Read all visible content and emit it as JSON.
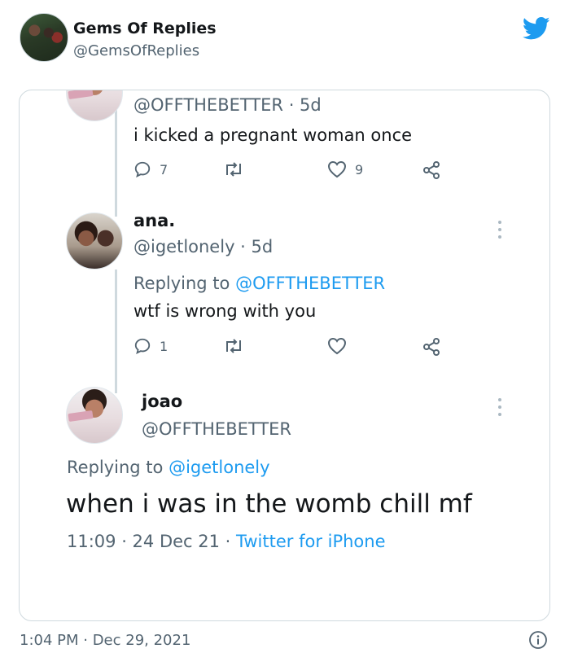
{
  "outer": {
    "display_name": "Gems Of Replies",
    "handle": "@GemsOfReplies",
    "avatar_icon": "profile-photo-group",
    "twitter_icon": "twitter-bird-icon",
    "brand_color": "#1d9bf0",
    "timestamp": "1:04 PM · Dec 29, 2021"
  },
  "tweets": [
    {
      "handle_line": "@OFFTHEBETTER · 5d",
      "text": "i kicked a pregnant woman once",
      "reply_count": "7",
      "like_count": "9"
    },
    {
      "name": "ana.",
      "handle_line": "@igetlonely · 5d",
      "replying_prefix": "Replying to ",
      "replying_to": "@OFFTHEBETTER",
      "text": "wtf is wrong with you",
      "reply_count": "1"
    },
    {
      "name": "joao",
      "handle": "@OFFTHEBETTER",
      "replying_prefix": "Replying to ",
      "replying_to": "@igetlonely",
      "text": "when i was in the womb chill mf",
      "time_date": "11:09 · 24 Dec 21 · ",
      "source": "Twitter for iPhone"
    }
  ]
}
